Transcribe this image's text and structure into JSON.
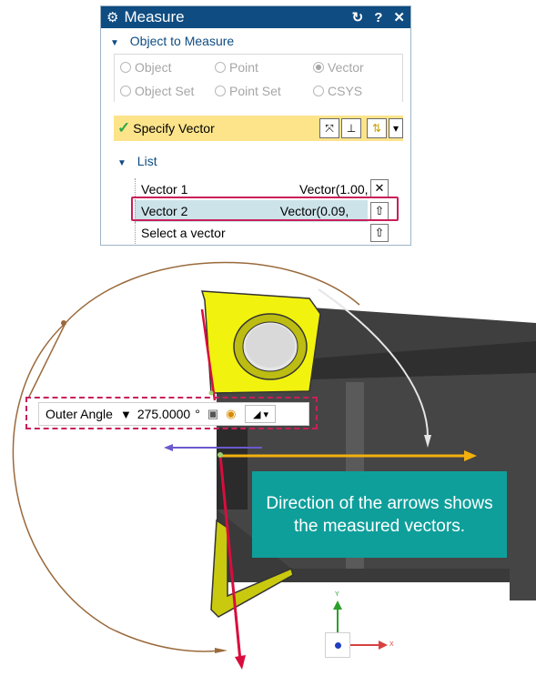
{
  "dialog": {
    "title": "Measure",
    "buttons": {
      "reset": "↻",
      "help": "?",
      "close": "✕"
    },
    "object_section": "Object to Measure",
    "radios": [
      {
        "label": "Object",
        "selected": false
      },
      {
        "label": "Point",
        "selected": false
      },
      {
        "label": "Vector",
        "selected": true
      },
      {
        "label": "Object Set",
        "selected": false
      },
      {
        "label": "Point Set",
        "selected": false
      },
      {
        "label": "CSYS",
        "selected": false
      }
    ],
    "specify_label": "Specify Vector",
    "list_section": "List",
    "list_rows": [
      {
        "name": "Vector 1",
        "value": "Vector(1.00,",
        "selected": false
      },
      {
        "name": "Vector 2",
        "value": "Vector(0.09,",
        "selected": true
      },
      {
        "name": "Select a vector",
        "value": "",
        "selected": false
      }
    ]
  },
  "angle_bar": {
    "label": "Outer Angle",
    "value": "275.0000",
    "unit": "°"
  },
  "callout": {
    "text": "Direction of the arrows shows the measured vectors."
  },
  "triad": {
    "y_label": "Y",
    "x_label": "X"
  },
  "colors": {
    "title_bar": "#0f4c81",
    "highlight": "#c8205a",
    "callout": "#0f9f9b",
    "specify_bg": "#fde48b",
    "selected_row": "#cce3ea",
    "vector_arrow_red": "#d90d3d",
    "vector_arrow_yellow": "#f2b10d",
    "insert_yellow": "#f2f20f",
    "body_gray": "#4b4b4b"
  }
}
